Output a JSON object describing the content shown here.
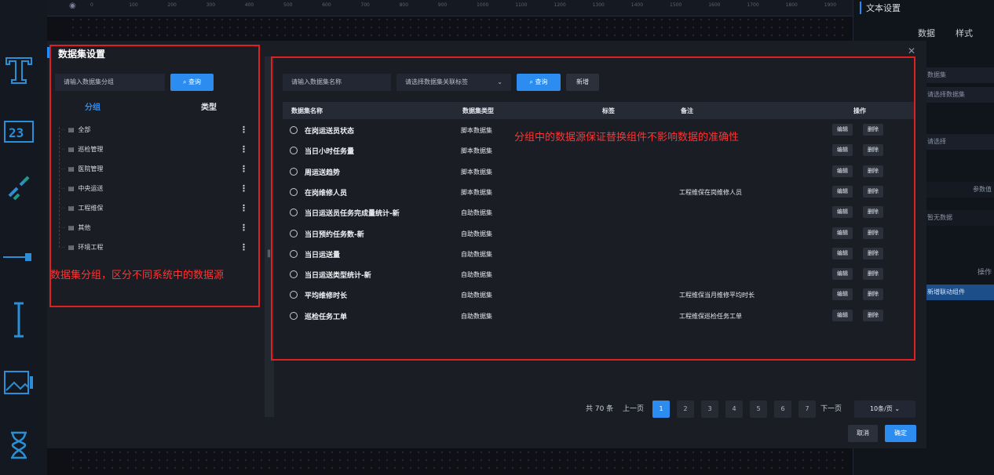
{
  "right_panel": {
    "title": "文本设置",
    "tabs": [
      "数据",
      "样式"
    ],
    "rows": [
      "数据集",
      "请选择数据集",
      "请选择",
      "参数值",
      "暂无数据",
      "操作",
      "新增联动组件"
    ]
  },
  "ruler_ticks": [
    "0",
    "100",
    "200",
    "300",
    "400",
    "500",
    "600",
    "700",
    "800",
    "900",
    "1000",
    "1100",
    "1200",
    "1300",
    "1400",
    "1500",
    "1600",
    "1700",
    "1800",
    "1900"
  ],
  "modal": {
    "title": "数据集设置",
    "close_icon": "close-icon",
    "group_panel": {
      "search_placeholder": "请输入数据集分组",
      "query_label": "查询",
      "tabs": [
        "分组",
        "类型"
      ],
      "groups": [
        "全部",
        "巡检管理",
        "医院管理",
        "中央运送",
        "工程维保",
        "其他",
        "环境工程"
      ]
    },
    "dataset_panel": {
      "name_placeholder": "请输入数据集名称",
      "tag_placeholder": "请选择数据集关联标签",
      "query_label": "查询",
      "add_label": "新增",
      "columns": [
        "数据集名称",
        "数据集类型",
        "标签",
        "备注",
        "操作"
      ],
      "rows": [
        {
          "name": "在岗运送员状态",
          "type": "脚本数据集",
          "tag": "",
          "remark": ""
        },
        {
          "name": "当日小时任务量",
          "type": "脚本数据集",
          "tag": "",
          "remark": ""
        },
        {
          "name": "周运送趋势",
          "type": "脚本数据集",
          "tag": "",
          "remark": ""
        },
        {
          "name": "在岗维修人员",
          "type": "脚本数据集",
          "tag": "",
          "remark": "工程维保在岗维修人员"
        },
        {
          "name": "当日运送员任务完成量统计-新",
          "type": "自助数据集",
          "tag": "",
          "remark": ""
        },
        {
          "name": "当日预约任务数-新",
          "type": "自助数据集",
          "tag": "",
          "remark": ""
        },
        {
          "name": "当日运送量",
          "type": "自助数据集",
          "tag": "",
          "remark": ""
        },
        {
          "name": "当日运送类型统计-新",
          "type": "自助数据集",
          "tag": "",
          "remark": ""
        },
        {
          "name": "平均维修时长",
          "type": "自助数据集",
          "tag": "",
          "remark": "工程维保当月维修平均时长"
        },
        {
          "name": "巡检任务工单",
          "type": "自助数据集",
          "tag": "",
          "remark": "工程维保巡检任务工单"
        }
      ],
      "edit_label": "编辑",
      "delete_label": "删除"
    },
    "pagination": {
      "total": "共 70 条",
      "prev": "上一页",
      "pages": [
        "1",
        "2",
        "3",
        "4",
        "5",
        "6",
        "7"
      ],
      "current_page": "1",
      "next": "下一页",
      "page_size": "10条/页"
    },
    "cancel_label": "取消",
    "confirm_label": "确定"
  },
  "annotations": {
    "group_note": "数据集分组，区分不同系统中的数据源",
    "dataset_note": "分组中的数据源保证替换组件不影响数据的准确性"
  },
  "colors": {
    "accent": "#2d8cf0",
    "annotation": "#e02020",
    "modal_bg": "#1a1d24"
  }
}
